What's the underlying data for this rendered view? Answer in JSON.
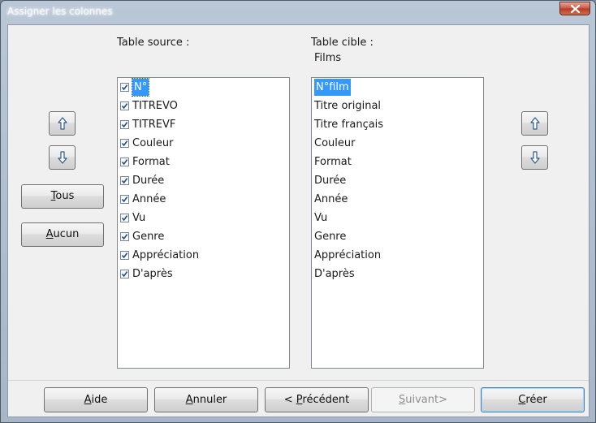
{
  "window": {
    "title": "Assigner les colonnes"
  },
  "source": {
    "label": "Table source :",
    "items": [
      {
        "label": "N°",
        "checked": true
      },
      {
        "label": "TITREVO",
        "checked": true
      },
      {
        "label": "TITREVF",
        "checked": true
      },
      {
        "label": "Couleur",
        "checked": true
      },
      {
        "label": "Format",
        "checked": true
      },
      {
        "label": "Durée",
        "checked": true
      },
      {
        "label": "Année",
        "checked": true
      },
      {
        "label": "Vu",
        "checked": true
      },
      {
        "label": "Genre",
        "checked": true
      },
      {
        "label": "Appréciation",
        "checked": true
      },
      {
        "label": "D'après",
        "checked": true
      }
    ]
  },
  "target": {
    "label": "Table cible :",
    "table_name": "Films",
    "items": [
      "N°film",
      "Titre original",
      "Titre français",
      "Couleur",
      "Format",
      "Durée",
      "Année",
      "Vu",
      "Genre",
      "Appréciation",
      "D'après"
    ]
  },
  "buttons": {
    "tous": {
      "accel": "T",
      "rest": "ous"
    },
    "aucun": {
      "accel": "A",
      "rest": "ucun"
    },
    "aide": {
      "accel": "A",
      "rest": "ide"
    },
    "annuler": {
      "accel": "A",
      "rest": "nnuler"
    },
    "precedent": {
      "pre": "< ",
      "accel": "P",
      "rest": "récédent"
    },
    "suivant": {
      "accel": "S",
      "rest": "uivant>"
    },
    "creer": {
      "accel": "C",
      "rest": "réer"
    }
  },
  "colors": {
    "selection": "#3399ff",
    "check": "#1f4e8c"
  }
}
